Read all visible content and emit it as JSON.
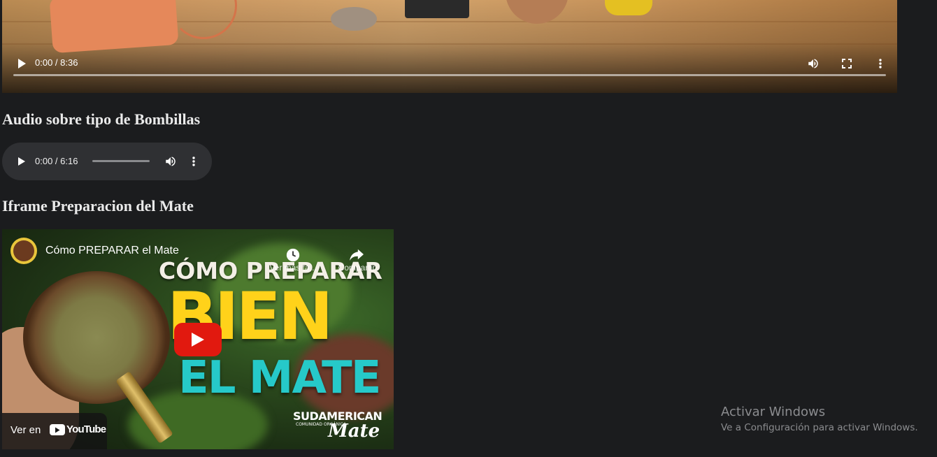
{
  "video": {
    "time": "0:00 / 8:36",
    "icons": {
      "play": "play-icon",
      "volume": "volume-icon",
      "fullscreen": "fullscreen-icon",
      "menu": "more-vert-icon"
    },
    "progress": 0
  },
  "audio_section": {
    "heading": "Audio sobre tipo de Bombillas",
    "time": "0:00 / 6:16",
    "progress": 0
  },
  "iframe_section": {
    "heading": "Iframe Preparacion del Mate",
    "video_title": "Cómo PREPARAR el Mate",
    "watch_later_label": "Ver más ta...",
    "share_label": "Compartir",
    "thumbnail_line1": "CÓMO PREPARAR",
    "thumbnail_line2": "BIEN",
    "thumbnail_line3": "EL MATE",
    "brand_name": "SUDAMERICAN",
    "brand_sub": "COMUNIDAD ORGÁNICA",
    "brand_script": "Mate",
    "watch_on_label": "Ver en",
    "youtube_label": "YouTube",
    "colors": {
      "title_yellow": "#ffd21a",
      "title_teal": "#26c9c9",
      "play_red": "#e1190f"
    }
  },
  "windows_watermark": {
    "title": "Activar Windows",
    "subtitle": "Ve a Configuración para activar Windows."
  }
}
